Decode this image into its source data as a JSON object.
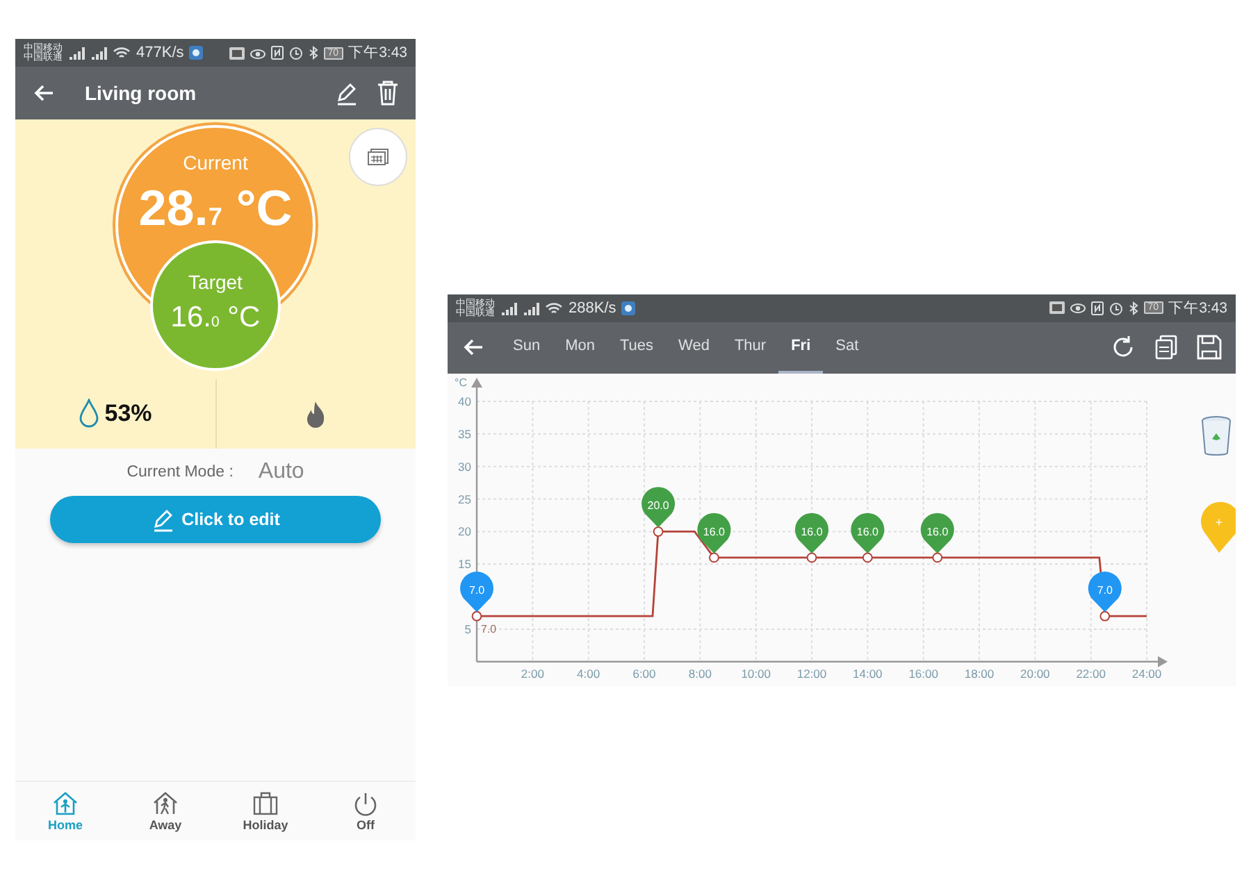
{
  "left_screen": {
    "status_bar": {
      "carriers": [
        "中国移动",
        "中国联通"
      ],
      "speed": "477K/s",
      "battery": "70",
      "time": "下午3:43"
    },
    "app_bar": {
      "title": "Living room"
    },
    "current": {
      "label": "Current",
      "value": "28.$_{7}$ °C"
    },
    "target": {
      "label": "Target",
      "value": "16.$_{0}$ °C"
    },
    "humidity": "53%",
    "mode": {
      "label": "Current Mode :",
      "value": "Auto"
    },
    "edit_button": "Click to edit",
    "bottom_nav": [
      {
        "label": "Home",
        "kind": "home",
        "selected": true
      },
      {
        "label": "Away",
        "kind": "away",
        "selected": false
      },
      {
        "label": "Holiday",
        "kind": "holiday",
        "selected": false
      },
      {
        "label": "Off",
        "kind": "off",
        "selected": false
      }
    ]
  },
  "right_screen": {
    "status_bar": {
      "carriers": [
        "中国移动",
        "中国联通"
      ],
      "speed": "288K/s",
      "battery": "70",
      "time": "下午3:43"
    },
    "point_label": "7.0",
    "marker_colors": [
      {
        "color": "#2196f3"
      },
      {
        "color": "#43a047"
      },
      {
        "color": "#43a047"
      },
      {
        "color": "#43a047"
      },
      {
        "color": "#43a047"
      },
      {
        "color": "#43a047"
      },
      {
        "color": "#2196f3"
      }
    ],
    "tabs": [
      {
        "label": "Sun",
        "selected": false
      },
      {
        "label": "Mon",
        "selected": false
      },
      {
        "label": "Tues",
        "selected": false
      },
      {
        "label": "Wed",
        "selected": false
      },
      {
        "label": "Thur",
        "selected": false
      },
      {
        "label": "Fri",
        "selected": true
      },
      {
        "label": "Sat",
        "selected": false
      }
    ],
    "chart_data": {
      "type": "line",
      "ylabel": "°C",
      "x": [
        0,
        6.3,
        6.5,
        7.8,
        8.5,
        12,
        14,
        16.5,
        22.3,
        22.5,
        24
      ],
      "series": [
        {
          "color": "#b5433a",
          "values": [
            7,
            7,
            20,
            20,
            16,
            16,
            16,
            16,
            16,
            7,
            7
          ]
        }
      ],
      "value_labels": [
        "7.0",
        null,
        "20.0",
        null,
        "16.0",
        "16.0",
        "16.0",
        "16.0",
        null,
        "7.0",
        null
      ],
      "grid": true,
      "xlim": [
        0,
        24
      ],
      "ylim": [
        0,
        40
      ],
      "xticks": [
        {
          "value": 2,
          "label": "2:00"
        },
        {
          "value": 4,
          "label": "4:00"
        },
        {
          "value": 6,
          "label": "6:00"
        },
        {
          "value": 8,
          "label": "8:00"
        },
        {
          "value": 10,
          "label": "10:00"
        },
        {
          "value": 12,
          "label": "12:00"
        },
        {
          "value": 14,
          "label": "14:00"
        },
        {
          "value": 16,
          "label": "16:00"
        },
        {
          "value": 18,
          "label": "18:00"
        },
        {
          "value": 20,
          "label": "20:00"
        },
        {
          "value": 22,
          "label": "22:00"
        },
        {
          "value": 24,
          "label": "24:00"
        }
      ],
      "yticks": [
        5,
        15,
        20,
        25,
        30,
        35,
        40
      ]
    },
    "add_marker": {
      "label": "+"
    }
  }
}
